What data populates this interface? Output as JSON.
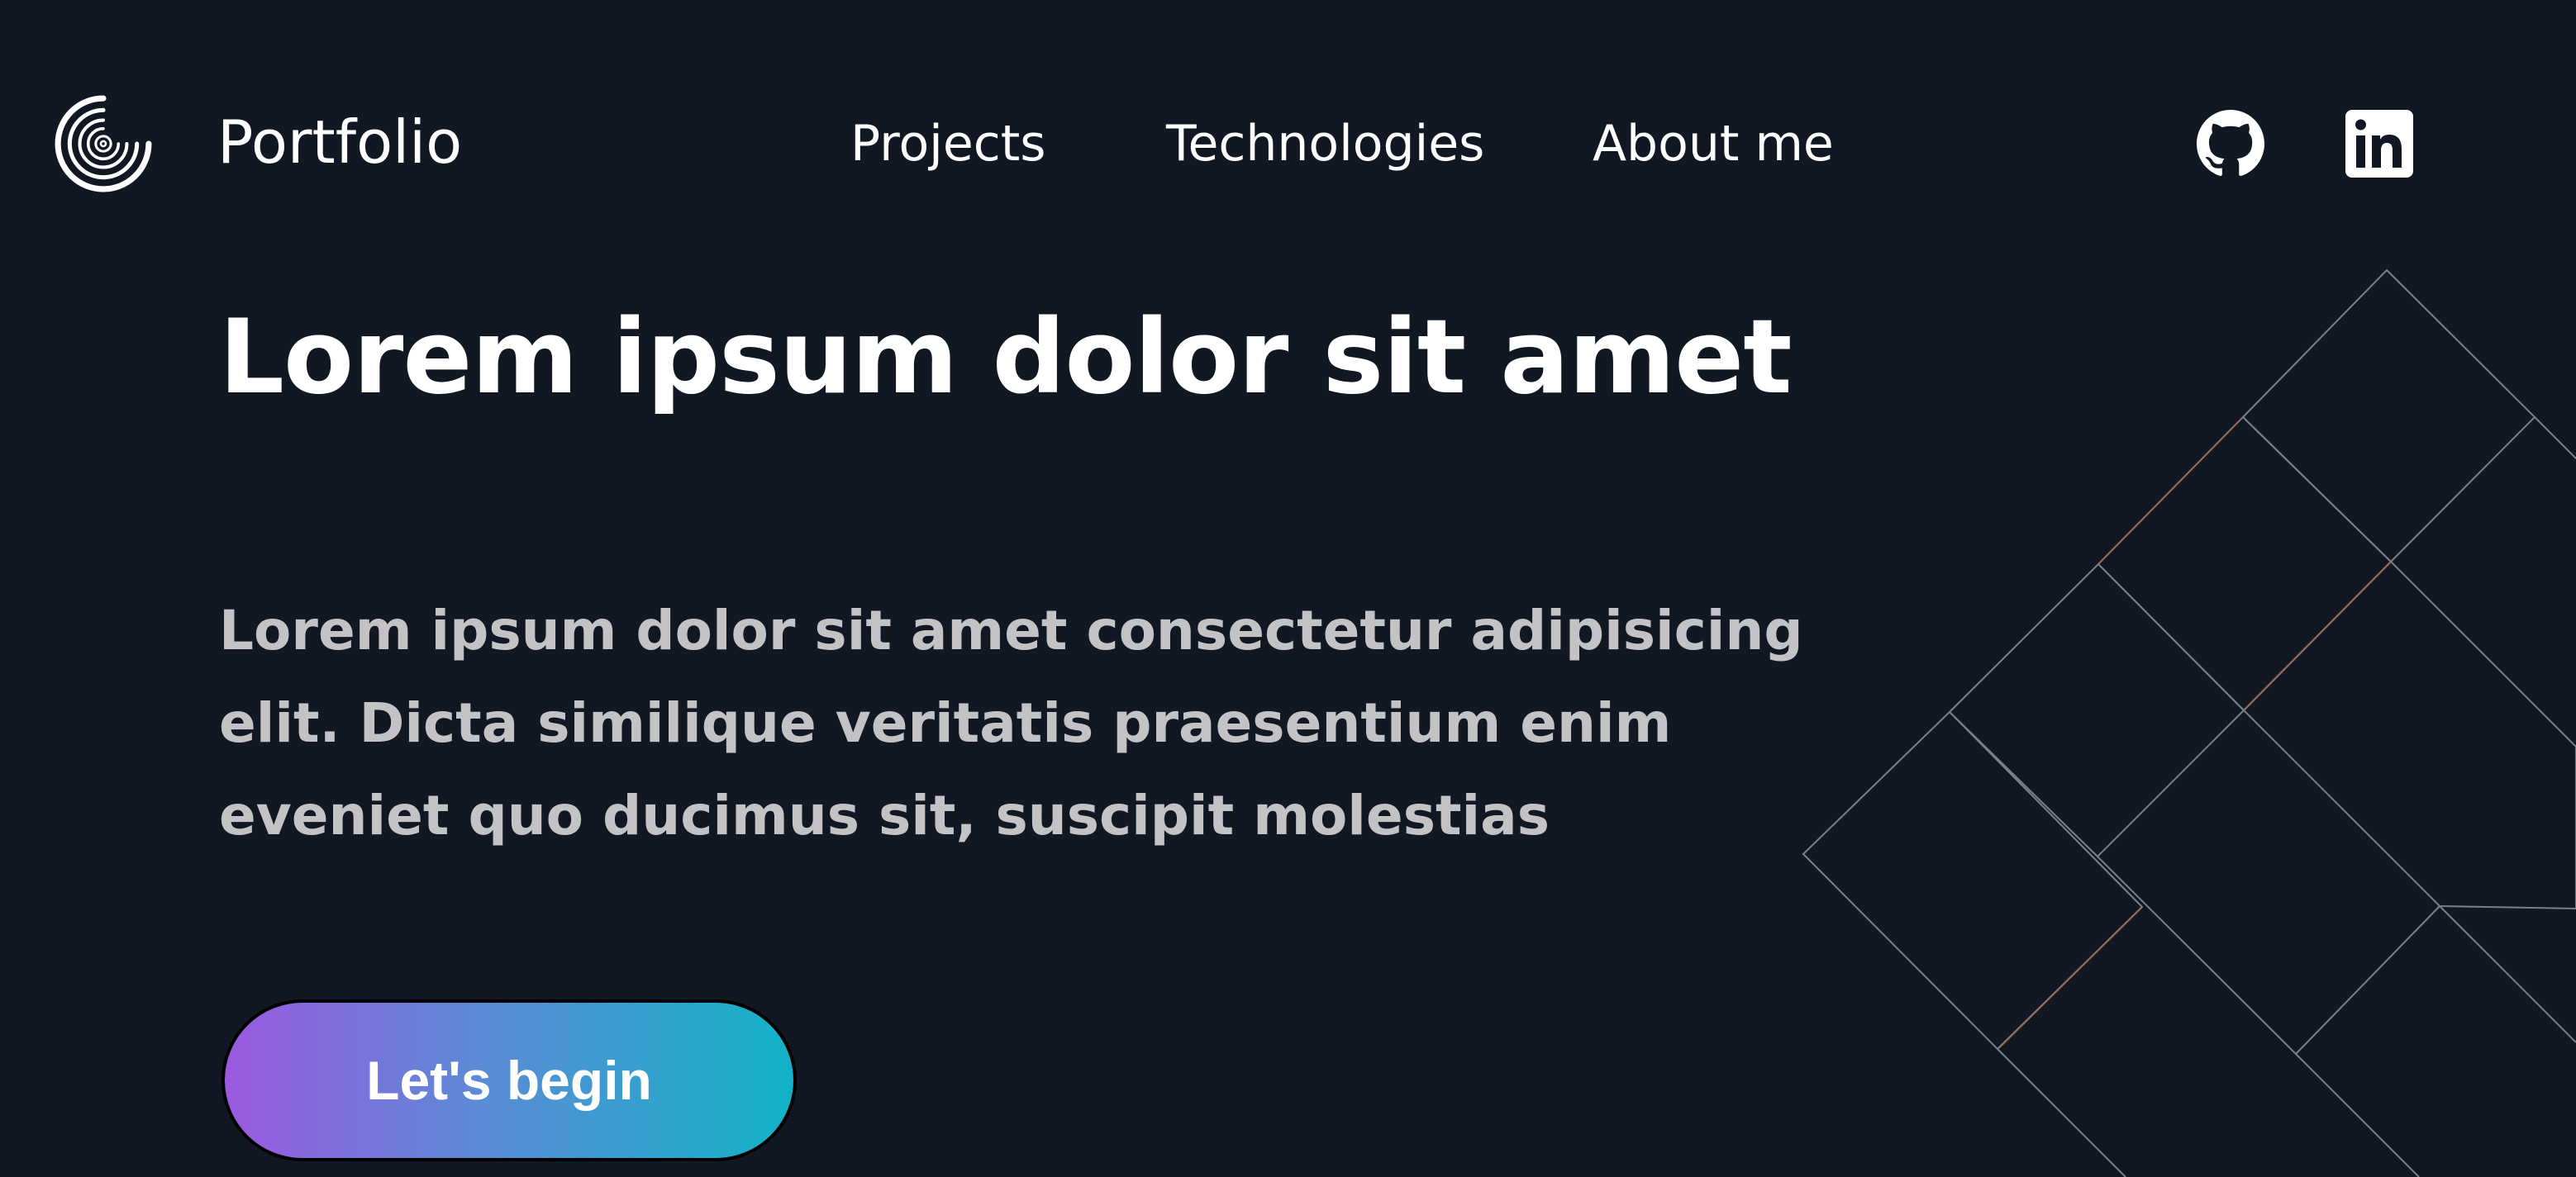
{
  "header": {
    "logo_icon": "spiral-logo-icon",
    "brand": "Portfolio",
    "nav": [
      {
        "label": "Projects"
      },
      {
        "label": "Technologies"
      },
      {
        "label": "About me"
      }
    ],
    "social": [
      {
        "icon": "github-icon"
      },
      {
        "icon": "linkedin-icon"
      }
    ]
  },
  "hero": {
    "title": "Lorem ipsum dolor sit amet",
    "text": "Lorem ipsum dolor sit amet consectetur adipisicing elit. Dicta similique veritatis praesentium enim eveniet quo ducimus sit, suscipit molestias",
    "cta_label": "Let's begin"
  },
  "colors": {
    "background": "#111824",
    "text": "#ffffff",
    "muted_text": "#c3c3c6",
    "gradient_start": "#9b59e0",
    "gradient_end": "#12b3c8",
    "pattern_line": "#7a7f8c",
    "pattern_accent": "#b15a2c"
  }
}
